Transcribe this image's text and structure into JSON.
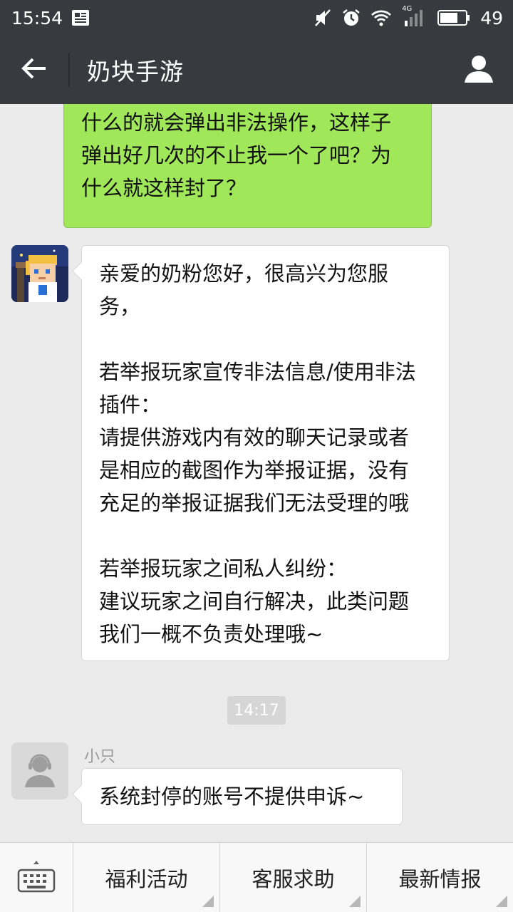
{
  "status_bar": {
    "time": "15:54",
    "network": "4G",
    "battery": "49"
  },
  "header": {
    "title": "奶块手游"
  },
  "messages": {
    "outgoing_1": "卡一个win，在win卡的时候挖东西\n什么的就会弹出非法操作，这样子\n弹出好几次的不止我一个了吧？为\n什么就这样封了？",
    "incoming_1": "亲爱的奶粉您好，很高兴为您服\n务，\n\n若举报玩家宣传非法信息/使用非法\n插件：\n请提供游戏内有效的聊天记录或者\n是相应的截图作为举报证据，没有\n充足的举报证据我们无法受理的哦\n\n若举报玩家之间私人纠纷：\n建议玩家之间自行解决，此类问题\n我们一概不负责处理哦~",
    "timestamp": "14:17",
    "sender_name": "小只",
    "incoming_2": "系统封停的账号不提供申诉~"
  },
  "bottom_menu": {
    "items": [
      "福利活动",
      "客服求助",
      "最新情报"
    ]
  }
}
